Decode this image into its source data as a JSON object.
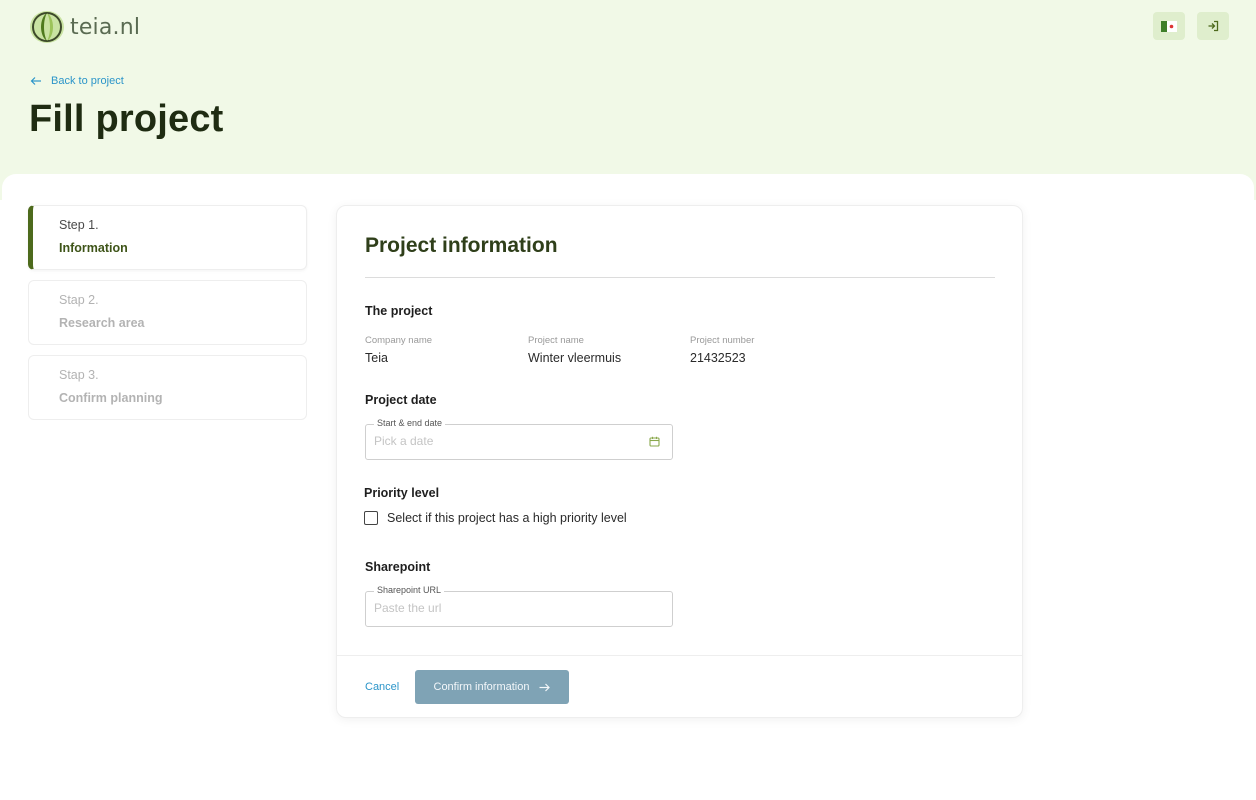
{
  "brand": {
    "name": "teia.nl"
  },
  "header": {
    "flag_button_icon": "flag-icon",
    "logout_button_icon": "logout-icon"
  },
  "nav": {
    "back_label": "Back to project"
  },
  "page": {
    "title": "Fill project"
  },
  "steps": [
    {
      "number": "Step 1.",
      "name": "Information",
      "active": true
    },
    {
      "number": "Stap 2.",
      "name": "Research area",
      "active": false
    },
    {
      "number": "Stap 3.",
      "name": "Confirm planning",
      "active": false
    }
  ],
  "card": {
    "title": "Project information",
    "project_section": {
      "title": "The project",
      "fields": [
        {
          "label": "Company name",
          "value": "Teia"
        },
        {
          "label": "Project name",
          "value": "Winter vleermuis"
        },
        {
          "label": "Project number",
          "value": "21432523"
        }
      ]
    },
    "date_section": {
      "title": "Project date",
      "field_label": "Start & end date",
      "placeholder": "Pick a date",
      "value": ""
    },
    "priority_section": {
      "title": "Priority level",
      "checkbox_label": "Select if this project has a high priority level",
      "checked": false
    },
    "sharepoint_section": {
      "title": "Sharepoint",
      "field_label": "Sharepoint URL",
      "placeholder": "Paste the url",
      "value": ""
    },
    "footer": {
      "cancel_label": "Cancel",
      "confirm_label": "Confirm information"
    }
  },
  "colors": {
    "hero_bg": "#f1f9e7",
    "accent_green": "#4d6a1c",
    "link_blue": "#2b95c9",
    "confirm_disabled": "#7fa3b5"
  }
}
